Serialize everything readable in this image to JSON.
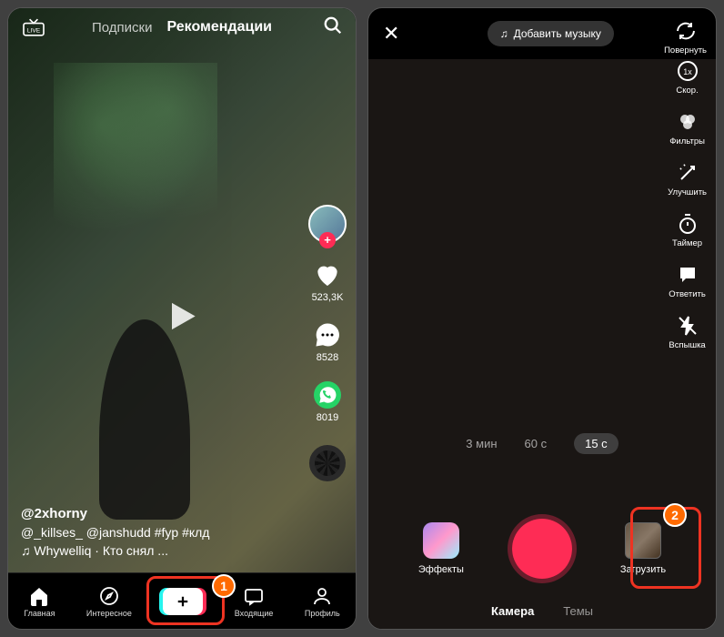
{
  "feed": {
    "tabs": {
      "following": "Подписки",
      "forYou": "Рекомендации"
    },
    "actions": {
      "likes": "523,3K",
      "comments": "8528",
      "shares": "8019"
    },
    "author": "@2xhorny",
    "caption": "@_killses_ @janshudd #fyp #клд",
    "sound": "♫  Whywelliq · Кто снял ...",
    "nav": {
      "home": "Главная",
      "discover": "Интересное",
      "inbox": "Входящие",
      "profile": "Профиль"
    }
  },
  "camera": {
    "addMusic": "Добавить музыку",
    "tools": {
      "flip": "Повернуть",
      "speed": "Скор.",
      "filters": "Фильтры",
      "beauty": "Улучшить",
      "timer": "Таймер",
      "reply": "Ответить",
      "flash": "Вспышка"
    },
    "durations": {
      "d3m": "3 мин",
      "d60": "60 с",
      "d15": "15 с"
    },
    "effects": "Эффекты",
    "upload": "Загрузить",
    "modes": {
      "camera": "Камера",
      "templates": "Темы"
    }
  },
  "badges": {
    "one": "1",
    "two": "2"
  }
}
